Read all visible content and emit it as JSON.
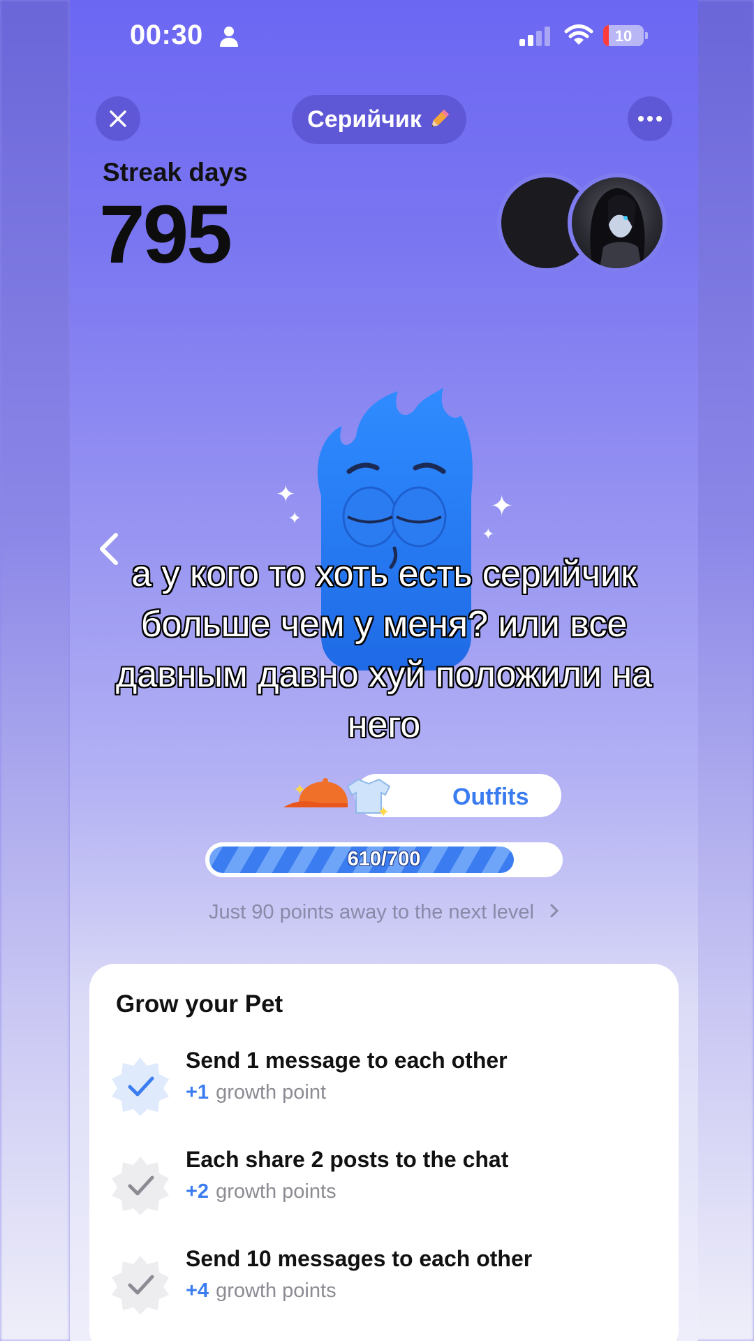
{
  "status_bar": {
    "time": "00:30",
    "battery": "10"
  },
  "header": {
    "title": "Серийчик"
  },
  "streak": {
    "label": "Streak days",
    "value": "795"
  },
  "overlay_caption": "а у кого то хоть есть серийчик больше чем у меня? или все давным давно хуй положили на него",
  "outfits": {
    "label": "Outfits"
  },
  "progress": {
    "text": "610/700",
    "current": 610,
    "max": 700
  },
  "next_level": {
    "text": "Just 90 points away to the next level"
  },
  "grow": {
    "title": "Grow your Pet",
    "tasks": [
      {
        "title": "Send 1 message to each other",
        "points": "+1",
        "unit": "growth point",
        "done": true
      },
      {
        "title": "Each share 2 posts to the chat",
        "points": "+2",
        "unit": "growth points",
        "done": false
      },
      {
        "title": "Send 10 messages to each other",
        "points": "+4",
        "unit": "growth points",
        "done": false
      }
    ]
  },
  "colors": {
    "accent": "#3b7df0",
    "bg_top": "#6c67f3",
    "card": "#ffffff"
  },
  "icons": [
    "person-icon",
    "signal-icon",
    "wifi-icon",
    "battery-icon",
    "close-icon",
    "pencil-icon",
    "more-icon",
    "back-arrow-icon",
    "sparkle-icon",
    "cap-icon",
    "shirt-icon",
    "check-badge-icon",
    "chevron-right-icon"
  ]
}
